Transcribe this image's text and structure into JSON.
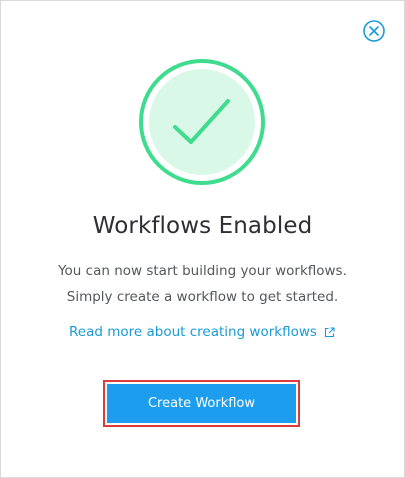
{
  "dialog": {
    "title": "Workflows Enabled",
    "description_line1": "You can now start building your workflows.",
    "description_line2": "Simply create a workflow to get started.",
    "read_more_link": "Read more about creating workflows",
    "create_button_label": "Create Workflow"
  },
  "icons": {
    "close": "close-circle-icon",
    "success": "checkmark-icon",
    "external": "external-link-icon"
  },
  "colors": {
    "accent_blue": "#1d9ded",
    "link_blue": "#1a9ad6",
    "success_green": "#3fdc8f",
    "success_fill": "#daf8e7",
    "highlight_red": "#dc3b3b",
    "title_text": "#2e2e33",
    "body_text": "#55575e"
  }
}
